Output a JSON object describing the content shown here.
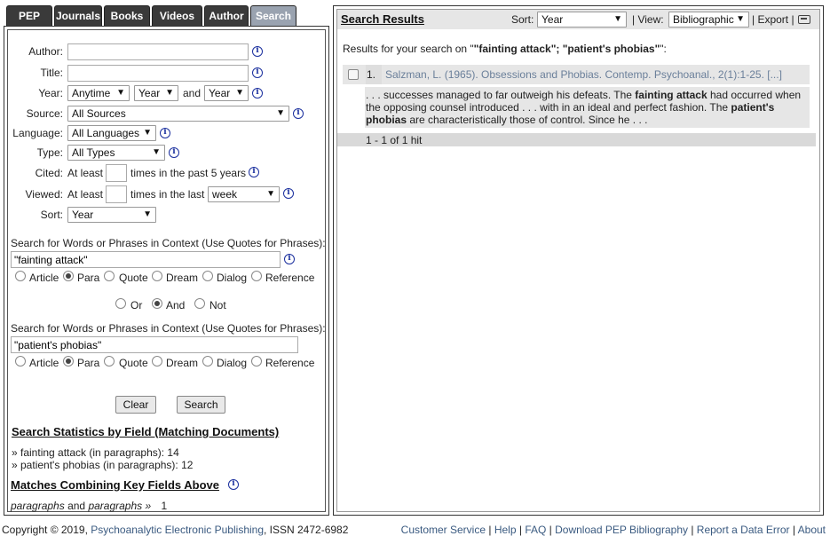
{
  "tabs": [
    {
      "label": "PEP",
      "active": false
    },
    {
      "label": "Journals",
      "active": false
    },
    {
      "label": "Books",
      "active": false
    },
    {
      "label": "Videos",
      "active": false
    },
    {
      "label": "Author",
      "active": false
    },
    {
      "label": "Search",
      "active": true
    }
  ],
  "form": {
    "author_label": "Author:",
    "author_value": "",
    "title_label": "Title:",
    "title_value": "",
    "year_label": "Year:",
    "year_mode": "Anytime",
    "year_from": "Year",
    "year_and": "and",
    "year_to": "Year",
    "source_label": "Source:",
    "source_value": "All Sources",
    "language_label": "Language:",
    "language_value": "All Languages",
    "type_label": "Type:",
    "type_value": "All Types",
    "cited_label": "Cited:",
    "cited_prefix": "At least",
    "cited_suffix": "times in the past 5 years",
    "viewed_label": "Viewed:",
    "viewed_prefix": "At least",
    "viewed_suffix": "times in the last",
    "viewed_period": "week",
    "sort_label": "Sort:",
    "sort_value": "Year",
    "context1_label": "Search for Words or Phrases in Context (Use Quotes for Phrases):",
    "context1_value": "\"fainting attack\"",
    "context2_label": "Search for Words or Phrases in Context (Use Quotes for Phrases):",
    "context2_value": "\"patient's phobias\"",
    "scope_options": [
      "Article",
      "Para",
      "Quote",
      "Dream",
      "Dialog",
      "Reference"
    ],
    "scope1_selected": "Para",
    "scope2_selected": "Para",
    "bool_options": [
      "Or",
      "And",
      "Not"
    ],
    "bool_selected": "And",
    "clear_label": "Clear",
    "search_label": "Search"
  },
  "stats": {
    "heading": "Search Statistics by Field (Matching Documents)",
    "lines": [
      "» fainting attack (in paragraphs): 14",
      "» patient's phobias (in paragraphs): 12"
    ],
    "combo_heading": "Matches Combining Key Fields Above",
    "combo_left": "paragraphs",
    "combo_and": "and",
    "combo_right": "paragraphs »",
    "combo_count": "1"
  },
  "results": {
    "title": "Search Results",
    "sort_label": "Sort:",
    "sort_value": "Year",
    "view_label": "| View:",
    "view_value": "Bibliographic",
    "export_label": "| Export |",
    "summary_prefix": "Results for your search on \"",
    "summary_query": "\"fainting attack\"; \"patient's phobias\"",
    "summary_suffix": "\":",
    "items": [
      {
        "number": "1.",
        "citation": "Salzman, L. (1965). Obsessions and Phobias. Contemp. Psychoanal., 2(1):1-25. [...]",
        "snippet_parts": [
          {
            "text": ". . . successes managed to far outweigh his defeats. The ",
            "bold": false
          },
          {
            "text": "fainting attack",
            "bold": true
          },
          {
            "text": " had occurred when the opposing counsel introduced . . . with in an ideal and perfect fashion. The ",
            "bold": false
          },
          {
            "text": "patient's phobias",
            "bold": true
          },
          {
            "text": " are characteristically those of control. Since he . . .",
            "bold": false
          }
        ]
      }
    ],
    "hits": "1 - 1 of 1 hit"
  },
  "footer": {
    "copyright_prefix": "Copyright © 2019, ",
    "publisher": "Psychoanalytic Electronic Publishing",
    "issn": ", ISSN 2472-6982",
    "links": [
      "Customer Service",
      "Help",
      "FAQ",
      "Download PEP Bibliography",
      "Report a Data Error",
      "About"
    ]
  },
  "colors": {
    "tab_bg": "#3a3a3a",
    "tab_active_bg": "#9aa3b0",
    "info_icon": "#1a2f9e",
    "result_bg": "#e6e6e6"
  }
}
